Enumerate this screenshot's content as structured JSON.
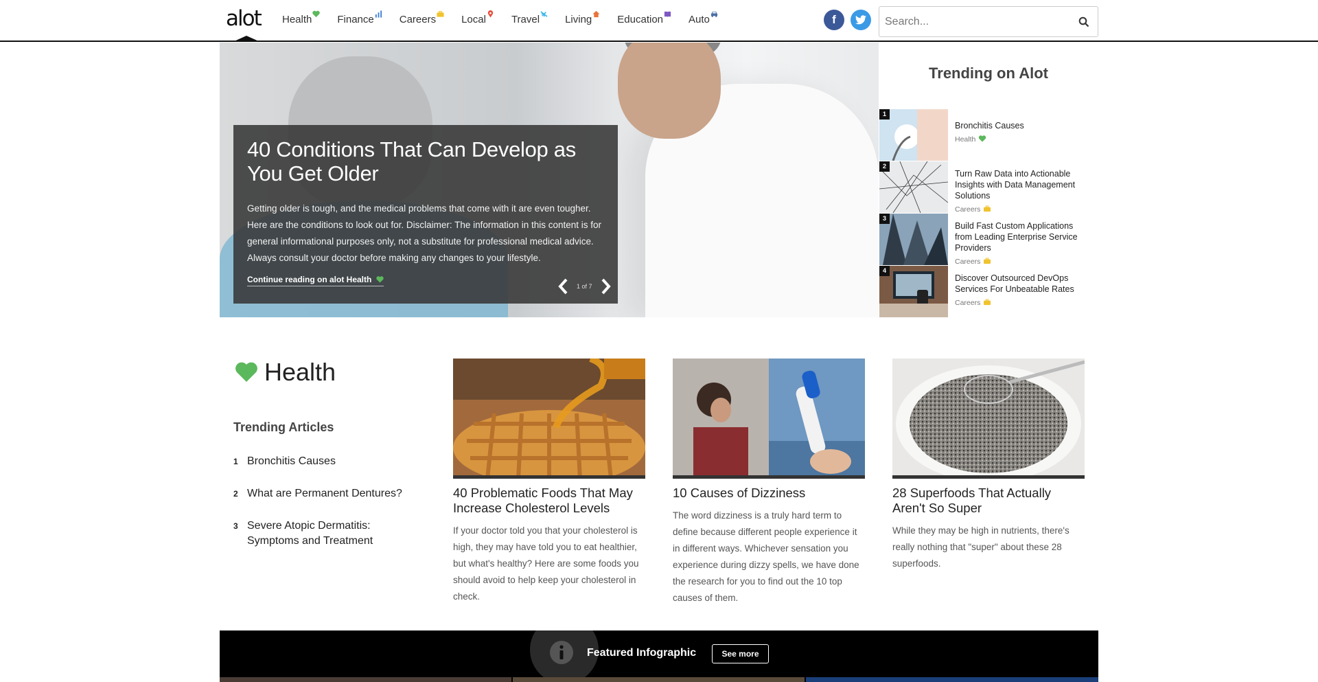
{
  "header": {
    "logo": "alot",
    "nav": [
      {
        "label": "Health",
        "icon": "heart-icon",
        "color": "#5cb85c"
      },
      {
        "label": "Finance",
        "icon": "bar-chart-icon",
        "color": "#3a7bd5"
      },
      {
        "label": "Careers",
        "icon": "briefcase-icon",
        "color": "#f0c330"
      },
      {
        "label": "Local",
        "icon": "map-pin-icon",
        "color": "#e74c3c"
      },
      {
        "label": "Travel",
        "icon": "plane-icon",
        "color": "#3bb6e8"
      },
      {
        "label": "Living",
        "icon": "house-icon",
        "color": "#e8743b"
      },
      {
        "label": "Education",
        "icon": "book-icon",
        "color": "#7e57c2"
      },
      {
        "label": "Auto",
        "icon": "car-icon",
        "color": "#4a6fa5"
      }
    ],
    "facebook": "f",
    "twitter": "t",
    "search_placeholder": "Search..."
  },
  "hero": {
    "title": "40 Conditions That Can Develop as You Get Older",
    "description": "Getting older is tough, and the medical problems that come with it are even tougher. Here are the conditions to look out for. Disclaimer: The information in this content is for general informational purposes only, not a substitute for professional medical advice. Always consult your doctor before making any changes to your lifestyle.",
    "link": "Continue reading on alot Health",
    "pager": "1 of 7"
  },
  "trending": {
    "title": "Trending on Alot",
    "items": [
      {
        "num": "1",
        "title": "Bronchitis Causes",
        "category": "Health",
        "icon": "heart-icon"
      },
      {
        "num": "2",
        "title": "Turn Raw Data into Actionable Insights with Data Management Solutions",
        "category": "Careers",
        "icon": "briefcase-icon"
      },
      {
        "num": "3",
        "title": "Build Fast Custom Applications from Leading Enterprise Service Providers",
        "category": "Careers",
        "icon": "briefcase-icon"
      },
      {
        "num": "4",
        "title": "Discover Outsourced DevOps Services For Unbeatable Rates",
        "category": "Careers",
        "icon": "briefcase-icon"
      }
    ]
  },
  "health": {
    "title": "Health",
    "trending_title": "Trending Articles",
    "trending": [
      {
        "num": "1",
        "label": "Bronchitis Causes"
      },
      {
        "num": "2",
        "label": "What are Permanent Dentures?"
      },
      {
        "num": "3",
        "label": "Severe Atopic Dermatitis: Symptoms and Treatment"
      }
    ],
    "cards": [
      {
        "title": "40 Problematic Foods That May Increase Cholesterol Levels",
        "description": "If your doctor told you that your cholesterol is high, they may have told you to eat healthier, but what's healthy? Here are some foods you should avoid to help keep your cholesterol in check."
      },
      {
        "title": "10 Causes of Dizziness",
        "description": "The word dizziness is a truly hard term to define because different people experience it in different ways. Whichever sensation you experience during dizzy spells, we have done the research for you to find out the 10 top causes of them."
      },
      {
        "title": "28 Superfoods That Actually Aren't So Super",
        "description": "While they may be high in nutrients, there's really nothing that \"super\" about these 28 superfoods."
      }
    ]
  },
  "featured": {
    "title": "Featured Infographic",
    "button": "See more"
  },
  "colors": {
    "health_green": "#5cb85c",
    "careers_yellow": "#f0c330",
    "hero_overlay": "#373737"
  }
}
